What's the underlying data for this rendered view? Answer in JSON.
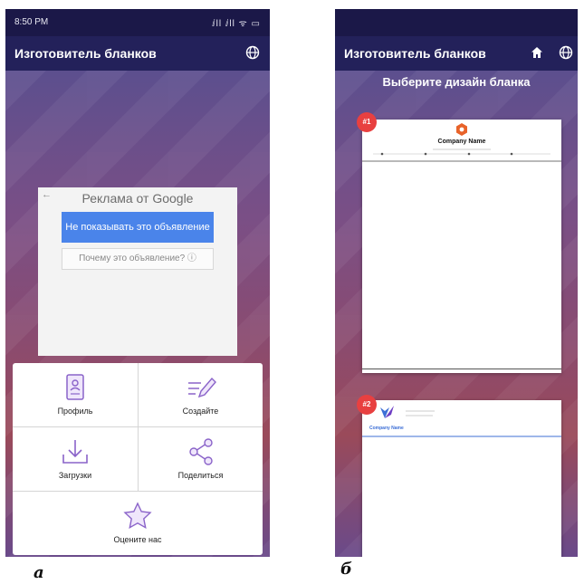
{
  "screen_a": {
    "status": {
      "time": "8:50 PM",
      "icons": "ⅈll ⅈll ᯤ ▭"
    },
    "app_title": "Изготовитель бланков",
    "globe_icon": "globe-icon",
    "ad": {
      "heading": "Реклама от Google",
      "hide_button": "Не показывать это объявление",
      "why_button": "Почему это объявление? ⓘ"
    },
    "menu": [
      {
        "label": "Профиль",
        "icon": "profile-icon"
      },
      {
        "label": "Создайте",
        "icon": "create-icon"
      },
      {
        "label": "Загрузки",
        "icon": "download-icon"
      },
      {
        "label": "Поделиться",
        "icon": "share-icon"
      },
      {
        "label": "Оцените нас",
        "icon": "star-icon"
      }
    ],
    "caption": "а"
  },
  "screen_b": {
    "app_title": "Изготовитель бланков",
    "heading": "Выберите дизайн бланка",
    "templates": [
      {
        "badge": "#1",
        "company": "Company Name"
      },
      {
        "badge": "#2",
        "company": "Company Name"
      }
    ],
    "caption": "б"
  },
  "colors": {
    "appbar": "#23215a",
    "accent": "#e84040",
    "menu_icon": "#8a63c9",
    "ad_button": "#4a84ea"
  }
}
